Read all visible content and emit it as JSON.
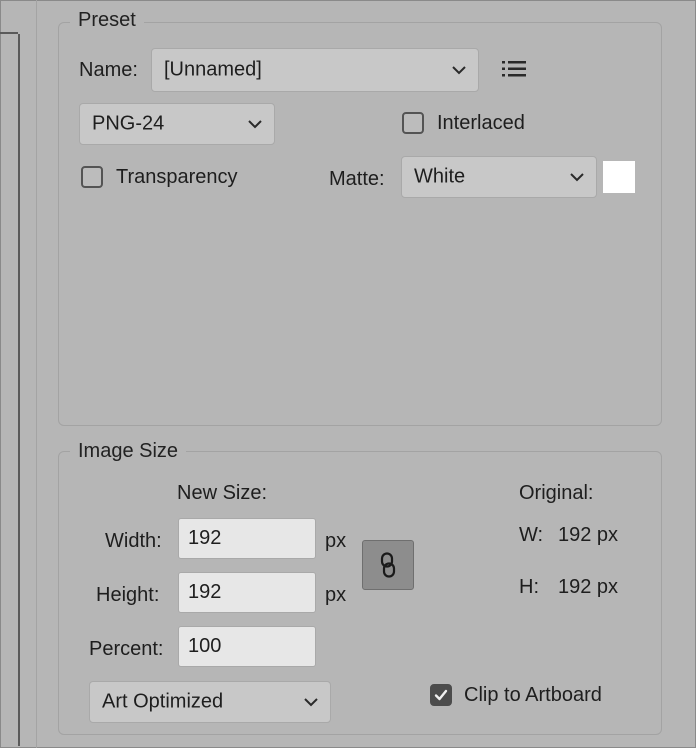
{
  "preset": {
    "legend": "Preset",
    "name_label": "Name:",
    "name_value": "[Unnamed]",
    "menu_icon": "list-menu-icon",
    "format_value": "PNG-24",
    "interlaced_label": "Interlaced",
    "interlaced_checked": false,
    "transparency_label": "Transparency",
    "transparency_checked": false,
    "matte_label": "Matte:",
    "matte_value": "White",
    "matte_color": "#ffffff"
  },
  "image_size": {
    "legend": "Image Size",
    "new_size_label": "New Size:",
    "original_label": "Original:",
    "width_label": "Width:",
    "width_value": "192",
    "width_unit": "px",
    "height_label": "Height:",
    "height_value": "192",
    "height_unit": "px",
    "percent_label": "Percent:",
    "percent_value": "100",
    "link_icon": "link-chain-icon",
    "orig_w_label": "W:",
    "orig_w_value": "192 px",
    "orig_h_label": "H:",
    "orig_h_value": "192 px",
    "quality_value": "Art Optimized",
    "clip_label": "Clip to Artboard",
    "clip_checked": true
  }
}
